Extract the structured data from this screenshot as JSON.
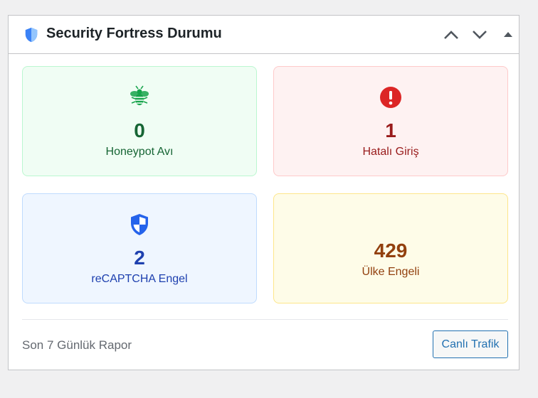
{
  "widget": {
    "title": "Security Fortress Durumu",
    "title_icon": "shield-icon",
    "controls": {
      "move_up_icon": "chevron-up-icon",
      "move_down_icon": "chevron-down-icon",
      "toggle_icon": "triangle-up-icon"
    }
  },
  "stats": {
    "honeypot": {
      "icon": "bee-icon",
      "value": "0",
      "label": "Honeypot Avı",
      "color": "#16a34a"
    },
    "failed_login": {
      "icon": "exclamation-circle-icon",
      "value": "1",
      "label": "Hatalı Giriş",
      "color": "#dc2626"
    },
    "recaptcha": {
      "icon": "shield-half-icon",
      "value": "2",
      "label": "reCAPTCHA Engel",
      "color": "#2563eb"
    },
    "country_block": {
      "value": "429",
      "label": "Ülke Engeli",
      "color": "#92400e"
    }
  },
  "footer": {
    "report_text": "Son 7 Günlük Rapor",
    "live_traffic_label": "Canlı Trafik"
  }
}
